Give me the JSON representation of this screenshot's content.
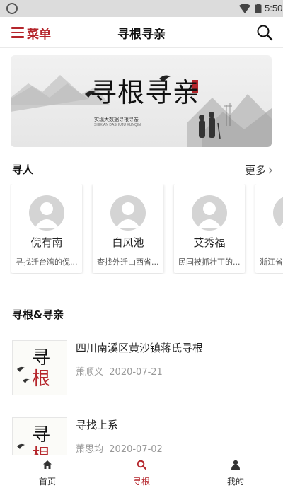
{
  "status_bar": {
    "time": "5:50"
  },
  "header": {
    "menu_label": "菜单",
    "title": "寻根寻亲"
  },
  "banner": {
    "title": "寻根寻亲",
    "subtitle": "实现大数据寻根寻亲",
    "subtitle_en": "SHIXIAN DASHUJU XUNQIN"
  },
  "people_section": {
    "title": "寻人",
    "more_label": "更多",
    "people": [
      {
        "name": "倪有南",
        "desc": "寻找迁台湾的倪..."
      },
      {
        "name": "白风池",
        "desc": "查找外迁山西省..."
      },
      {
        "name": "艾秀福",
        "desc": "民国被抓壮丁的..."
      },
      {
        "name": "计",
        "desc": "浙江省"
      }
    ]
  },
  "articles_section": {
    "title": "寻根&寻亲",
    "articles": [
      {
        "title": "四川南溪区黄沙镇蒋氏寻根",
        "author": "萧顺义",
        "date": "2020-07-21",
        "thumb_text_1": "寻",
        "thumb_text_2": "根"
      },
      {
        "title": "寻找上系",
        "author": "萧思均",
        "date": "2020-07-02",
        "thumb_text_1": "寻",
        "thumb_text_2": "根"
      }
    ]
  },
  "bottom_nav": {
    "items": [
      {
        "label": "首页",
        "icon": "home-icon"
      },
      {
        "label": "寻根",
        "icon": "search-icon"
      },
      {
        "label": "我的",
        "icon": "user-icon"
      }
    ],
    "active_index": 1
  },
  "colors": {
    "accent": "#b5262c",
    "background": "#ffffff",
    "status_bar": "#dcdcdc"
  }
}
